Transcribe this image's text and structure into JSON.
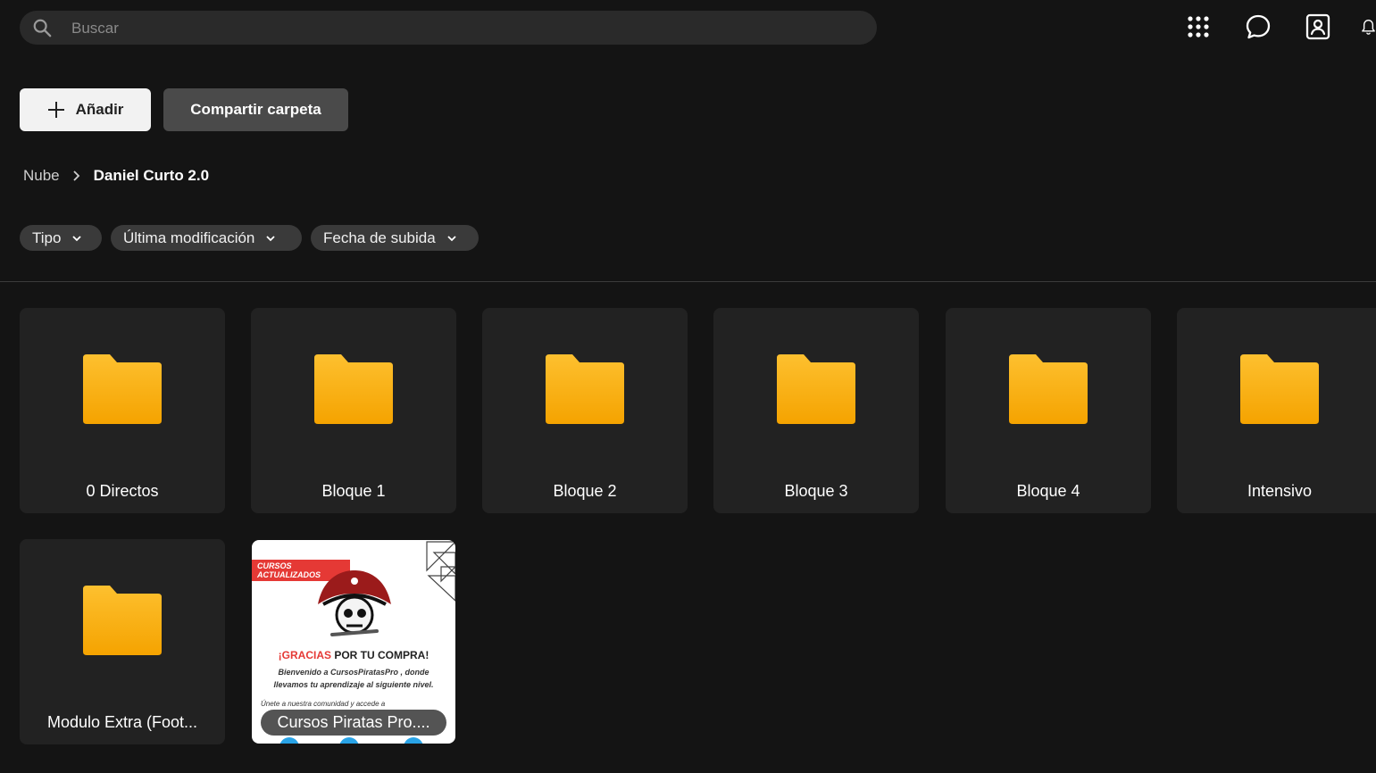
{
  "search": {
    "placeholder": "Buscar"
  },
  "top_icons": [
    "apps-grid-icon",
    "chat-icon",
    "contact-icon",
    "bell-icon"
  ],
  "actions": {
    "add_label": "Añadir",
    "share_label": "Compartir carpeta"
  },
  "breadcrumb": {
    "root": "Nube",
    "current": "Daniel Curto 2.0"
  },
  "filters": [
    "Tipo",
    "Última modificación",
    "Fecha de subida"
  ],
  "folders": [
    "0 Directos",
    "Bloque 1",
    "Bloque 2",
    "Bloque 3",
    "Bloque 4",
    "Intensivo",
    "Modulo Extra (Foot..."
  ],
  "file": {
    "name": "Cursos Piratas Pro....",
    "thumbnail": {
      "banner": "CURSOS ACTUALIZADOS",
      "headline_red": "¡GRACIAS",
      "headline_rest": " POR TU COMPRA!",
      "line1": "Bienvenido a CursosPiratasPro , donde",
      "line2": "llevamos tu aprendizaje al siguiente nivel.",
      "line3": "Únete a nuestra comunidad y accede a"
    }
  },
  "colors": {
    "background": "#141414",
    "tile": "#222222",
    "folder_top": "#FDC02F",
    "folder_bottom": "#F5A300",
    "accent_red": "#e53935"
  }
}
